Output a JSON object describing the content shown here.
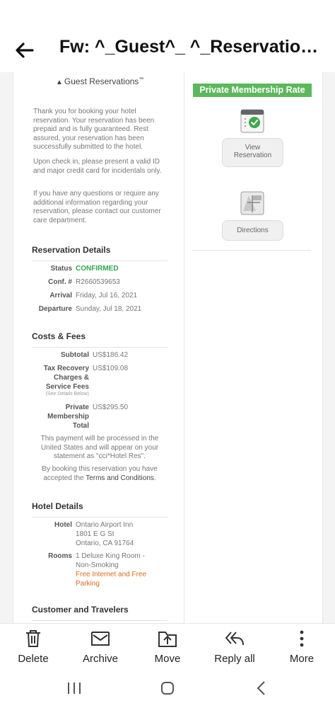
{
  "header": {
    "title": "Fw: ^_Guest^_ ^_Reservatio…"
  },
  "email": {
    "brand": "Guest Reservations",
    "brand_mark": "™",
    "intro_1": "Thank you for booking your hotel reservation. Your reservation has been prepaid and is fully guaranteed. Rest assured, your reservation has been successfully submitted to the hotel.",
    "intro_2": "Upon check in, please present a valid ID and major credit card for incidentals only.",
    "intro_3": "If you have any questions or require any additional information regarding your reservation, please contact our customer care department.",
    "reservation": {
      "heading": "Reservation Details",
      "status_label": "Status",
      "status_value": "CONFIRMED",
      "conf_label": "Conf. #",
      "conf_value": "R2660539653",
      "arrival_label": "Arrival",
      "arrival_value": "Friday, Jul 16, 2021",
      "departure_label": "Departure",
      "departure_value": "Sunday, Jul 18, 2021"
    },
    "costs": {
      "heading": "Costs & Fees",
      "subtotal_label": "Subtotal",
      "subtotal_value": "US$186.42",
      "tax_label_1": "Tax Recovery",
      "tax_label_2": "Charges &",
      "tax_label_3": "Service Fees",
      "tax_note": "(See Details Below)",
      "tax_value": "US$109.08",
      "pm_label_1": "Private",
      "pm_label_2": "Membership",
      "pm_label_3": "Total",
      "pm_value": "US$295.50",
      "payment_note": "This payment will be processed in the United States and will appear on your statement as \"cci*Hotel Res\".",
      "terms_prefix": "By booking this reservation you have accepted the ",
      "terms_link": "Terms and Conditions",
      "terms_suffix": "."
    },
    "hotel": {
      "heading": "Hotel Details",
      "hotel_label": "Hotel",
      "hotel_name": "Ontario Airport Inn",
      "hotel_addr1": "1801 E G St",
      "hotel_addr2": "Ontario, CA 91764",
      "rooms_label": "Rooms",
      "rooms_1": "1 Deluxe King Room -",
      "rooms_2": "Non-Smoking",
      "amenity_1": "Free Internet and Free",
      "amenity_2": "Parking"
    },
    "customer": {
      "heading": "Customer and Travelers"
    },
    "sidebar": {
      "badge": "Private Membership Rate",
      "view_1": "View",
      "view_2": "Reservation",
      "directions": "Directions"
    }
  },
  "actions": {
    "delete": "Delete",
    "archive": "Archive",
    "move": "Move",
    "reply_all": "Reply all",
    "more": "More"
  },
  "colors": {
    "confirmed": "#2fa84f",
    "badge": "#5cb85c",
    "amenity": "#e06a1a"
  }
}
